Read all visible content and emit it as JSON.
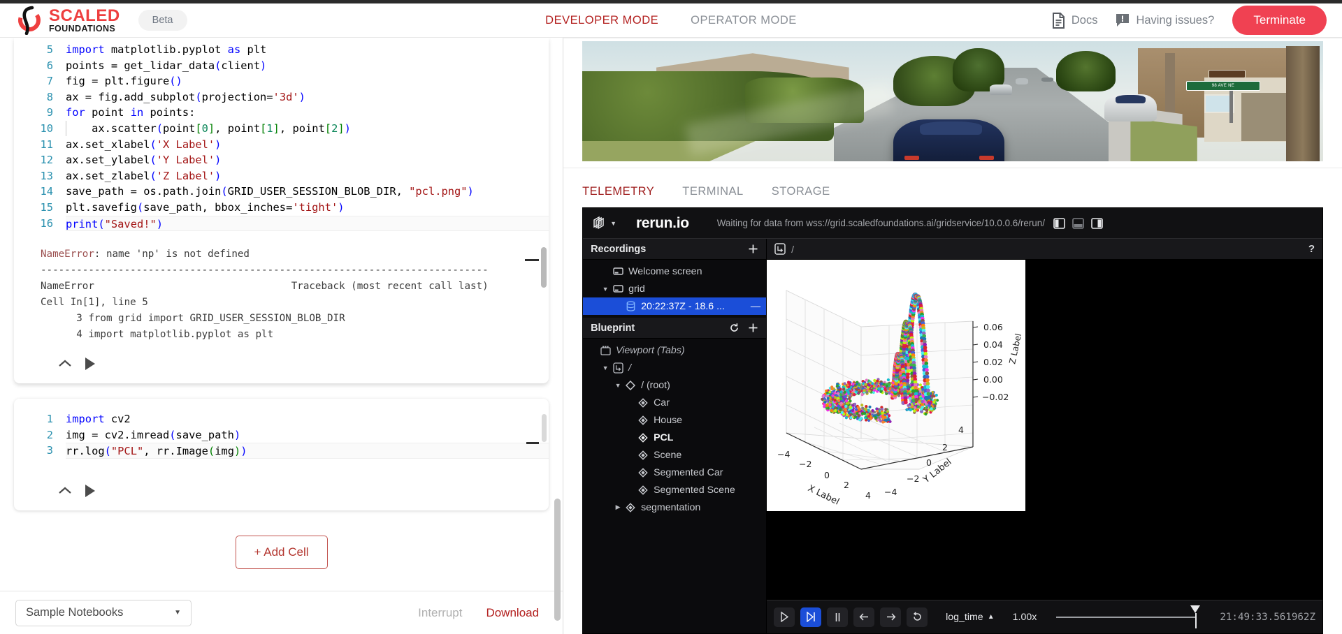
{
  "header": {
    "brand_primary": "SCALED",
    "brand_secondary": "FOUNDATIONS",
    "beta_label": "Beta",
    "modes": [
      {
        "label": "DEVELOPER MODE",
        "active": true
      },
      {
        "label": "OPERATOR MODE",
        "active": false
      }
    ],
    "docs_label": "Docs",
    "docs_icon": "document-icon",
    "issues_label": "Having issues?",
    "issues_icon": "feedback-icon",
    "terminate_label": "Terminate",
    "accent_red": "#b3201f",
    "terminate_bg": "#f04152"
  },
  "notebook": {
    "cell1": {
      "lines": [
        {
          "no": "5",
          "tokens": [
            {
              "t": "import",
              "c": "kw"
            },
            {
              "t": " matplotlib.pyplot ",
              "c": "plain"
            },
            {
              "t": "as",
              "c": "kw"
            },
            {
              "t": " plt",
              "c": "plain"
            }
          ]
        },
        {
          "no": "6",
          "tokens": [
            {
              "t": "points = get_lidar_data",
              "c": "plain"
            },
            {
              "t": "(",
              "c": "br-b"
            },
            {
              "t": "client",
              "c": "plain"
            },
            {
              "t": ")",
              "c": "br-b"
            }
          ]
        },
        {
          "no": "7",
          "tokens": [
            {
              "t": "fig = plt.figure",
              "c": "plain"
            },
            {
              "t": "()",
              "c": "br-b"
            }
          ]
        },
        {
          "no": "8",
          "tokens": [
            {
              "t": "ax = fig.add_subplot",
              "c": "plain"
            },
            {
              "t": "(",
              "c": "br-b"
            },
            {
              "t": "projection=",
              "c": "plain"
            },
            {
              "t": "'3d'",
              "c": "str"
            },
            {
              "t": ")",
              "c": "br-b"
            }
          ]
        },
        {
          "no": "9",
          "tokens": [
            {
              "t": "for",
              "c": "kw"
            },
            {
              "t": " point ",
              "c": "plain"
            },
            {
              "t": "in",
              "c": "kw"
            },
            {
              "t": " points:",
              "c": "plain"
            }
          ]
        },
        {
          "no": "10",
          "indent": true,
          "tokens": [
            {
              "t": "    ax.scatter",
              "c": "plain"
            },
            {
              "t": "(",
              "c": "br-b"
            },
            {
              "t": "point",
              "c": "plain"
            },
            {
              "t": "[",
              "c": "br-g"
            },
            {
              "t": "0",
              "c": "num"
            },
            {
              "t": "]",
              "c": "br-g"
            },
            {
              "t": ", point",
              "c": "plain"
            },
            {
              "t": "[",
              "c": "br-g"
            },
            {
              "t": "1",
              "c": "num"
            },
            {
              "t": "]",
              "c": "br-g"
            },
            {
              "t": ", point",
              "c": "plain"
            },
            {
              "t": "[",
              "c": "br-g"
            },
            {
              "t": "2",
              "c": "num"
            },
            {
              "t": "]",
              "c": "br-g"
            },
            {
              "t": ")",
              "c": "br-b"
            }
          ]
        },
        {
          "no": "11",
          "tokens": [
            {
              "t": "ax.set_xlabel",
              "c": "plain"
            },
            {
              "t": "(",
              "c": "br-b"
            },
            {
              "t": "'X Label'",
              "c": "str"
            },
            {
              "t": ")",
              "c": "br-b"
            }
          ]
        },
        {
          "no": "12",
          "tokens": [
            {
              "t": "ax.set_ylabel",
              "c": "plain"
            },
            {
              "t": "(",
              "c": "br-b"
            },
            {
              "t": "'Y Label'",
              "c": "str"
            },
            {
              "t": ")",
              "c": "br-b"
            }
          ]
        },
        {
          "no": "13",
          "tokens": [
            {
              "t": "ax.set_zlabel",
              "c": "plain"
            },
            {
              "t": "(",
              "c": "br-b"
            },
            {
              "t": "'Z Label'",
              "c": "str"
            },
            {
              "t": ")",
              "c": "br-b"
            }
          ]
        },
        {
          "no": "14",
          "tokens": [
            {
              "t": "save_path = os.path.join",
              "c": "plain"
            },
            {
              "t": "(",
              "c": "br-b"
            },
            {
              "t": "GRID_USER_SESSION_BLOB_DIR, ",
              "c": "plain"
            },
            {
              "t": "\"pcl.png\"",
              "c": "str"
            },
            {
              "t": ")",
              "c": "br-b"
            }
          ]
        },
        {
          "no": "15",
          "tokens": [
            {
              "t": "plt.savefig",
              "c": "plain"
            },
            {
              "t": "(",
              "c": "br-b"
            },
            {
              "t": "save_path, bbox_inches=",
              "c": "plain"
            },
            {
              "t": "'tight'",
              "c": "str"
            },
            {
              "t": ")",
              "c": "br-b"
            }
          ]
        },
        {
          "no": "16",
          "active": true,
          "tokens": [
            {
              "t": "print",
              "c": "fn"
            },
            {
              "t": "(",
              "c": "br-b"
            },
            {
              "t": "\"Saved!\"",
              "c": "str"
            },
            {
              "t": ")",
              "c": "br-b"
            }
          ]
        }
      ],
      "output": [
        {
          "text": "NameError: name 'np' is not defined",
          "err_prefix": "NameError"
        },
        {
          "text": "---------------------------------------------------------------------------"
        },
        {
          "text": "NameError                                 Traceback (most recent call last)"
        },
        {
          "text": "Cell In[1], line 5"
        },
        {
          "text": "      3 from grid import GRID_USER_SESSION_BLOB_DIR"
        },
        {
          "text": "      4 import matplotlib.pyplot as plt"
        }
      ]
    },
    "cell2": {
      "lines": [
        {
          "no": "1",
          "tokens": [
            {
              "t": "import",
              "c": "kw"
            },
            {
              "t": " cv2",
              "c": "plain"
            }
          ]
        },
        {
          "no": "2",
          "tokens": [
            {
              "t": "img = cv2.imread",
              "c": "plain"
            },
            {
              "t": "(",
              "c": "br-b"
            },
            {
              "t": "save_path",
              "c": "plain"
            },
            {
              "t": ")",
              "c": "br-b"
            }
          ]
        },
        {
          "no": "3",
          "active": true,
          "tokens": [
            {
              "t": "rr.log",
              "c": "plain"
            },
            {
              "t": "(",
              "c": "br-b"
            },
            {
              "t": "\"PCL\"",
              "c": "str"
            },
            {
              "t": ", rr.Image",
              "c": "plain"
            },
            {
              "t": "(",
              "c": "br-g"
            },
            {
              "t": "img",
              "c": "plain"
            },
            {
              "t": ")",
              "c": "br-g"
            },
            {
              "t": ")",
              "c": "br-b"
            }
          ]
        }
      ]
    },
    "add_cell_label": "+ Add Cell",
    "collapse_icon": "chevron-up-icon",
    "run_icon": "play-icon"
  },
  "left_footer": {
    "sample_notebooks_label": "Sample Notebooks",
    "dropdown_icon": "chevron-down-icon",
    "interrupt_label": "Interrupt",
    "download_label": "Download"
  },
  "camera": {
    "street_sign_label": "98 AVE NE",
    "alt": "simulated-driving-camera-feed"
  },
  "panel_tabs": [
    {
      "label": "TELEMETRY",
      "active": true
    },
    {
      "label": "TERMINAL",
      "active": false
    },
    {
      "label": "STORAGE",
      "active": false
    }
  ],
  "rerun": {
    "menu_icon": "rerun-logo-icon",
    "brand": "rerun.io",
    "status": "Waiting for data from wss://grid.scaledfoundations.ai/gridservice/10.0.0.6/rerun/",
    "layout_buttons": [
      "panel-left-icon",
      "panel-bottom-icon",
      "panel-right-icon"
    ],
    "recordings": {
      "title": "Recordings",
      "add_icon": "plus-icon",
      "items": [
        {
          "label": "Welcome screen",
          "icon": "recording-icon",
          "depth": 1,
          "twisty": ""
        },
        {
          "label": "grid",
          "icon": "recording-icon",
          "depth": 1,
          "twisty": "down"
        },
        {
          "label": "20:22:37Z - 18.6 ...",
          "icon": "database-icon",
          "depth": 2,
          "selected": true,
          "trailing": "—"
        }
      ]
    },
    "blueprint": {
      "title": "Blueprint",
      "reset_icon": "reset-icon",
      "add_icon": "plus-icon",
      "items": [
        {
          "label": "Viewport (Tabs)",
          "icon": "viewport-icon",
          "depth": 0,
          "italic": true,
          "twisty": ""
        },
        {
          "label": "/",
          "icon": "container-icon",
          "depth": 1,
          "twisty": "down",
          "italic": true
        },
        {
          "label": "/ (root)",
          "icon": "space-view-icon",
          "depth": 2,
          "twisty": "down"
        },
        {
          "label": "Car",
          "icon": "entity-icon",
          "depth": 3,
          "twisty": ""
        },
        {
          "label": "House",
          "icon": "entity-icon",
          "depth": 3,
          "twisty": ""
        },
        {
          "label": "PCL",
          "icon": "entity-icon",
          "depth": 3,
          "twisty": "",
          "bold": true
        },
        {
          "label": "Scene",
          "icon": "entity-icon",
          "depth": 3,
          "twisty": ""
        },
        {
          "label": "Segmented Car",
          "icon": "entity-icon",
          "depth": 3,
          "twisty": ""
        },
        {
          "label": "Segmented Scene",
          "icon": "entity-icon",
          "depth": 3,
          "twisty": ""
        },
        {
          "label": "segmentation",
          "icon": "entity-icon",
          "depth": 2,
          "twisty": "right"
        }
      ]
    },
    "breadcrumb": {
      "icon": "container-icon",
      "text": "/",
      "help": "?"
    },
    "timeline": {
      "buttons": [
        {
          "icon": "play-icon",
          "on": false
        },
        {
          "icon": "follow-icon",
          "on": true
        },
        {
          "icon": "pause-icon",
          "on": false
        },
        {
          "icon": "step-back-icon",
          "on": false
        },
        {
          "icon": "step-forward-icon",
          "on": false
        },
        {
          "icon": "loop-icon",
          "on": false
        }
      ],
      "timeline_name": "log_time",
      "timeline_caret": "▲",
      "rate": "1.00x",
      "current_time": "21:49:33.561962Z"
    }
  },
  "chart_data": {
    "type": "scatter",
    "title": "",
    "xlabel": "X Label",
    "ylabel": "Y Label",
    "zlabel": "Z Label",
    "xticks": [
      -4,
      -2,
      0,
      2,
      4
    ],
    "yticks": [
      -4,
      -2,
      0,
      2,
      4
    ],
    "zticks": [
      -0.02,
      0.0,
      0.02,
      0.04,
      0.06
    ],
    "xlim": [
      -5,
      5
    ],
    "ylim": [
      -5,
      5
    ],
    "zlim": [
      -0.03,
      0.07
    ],
    "grid": true,
    "legend": false,
    "description": "3D lidar point cloud scatter; ground ring of points at z~0 plus three vertical arch-shaped clusters rising to z~0.06",
    "projection": "3d",
    "point_count_approx": 3000
  }
}
